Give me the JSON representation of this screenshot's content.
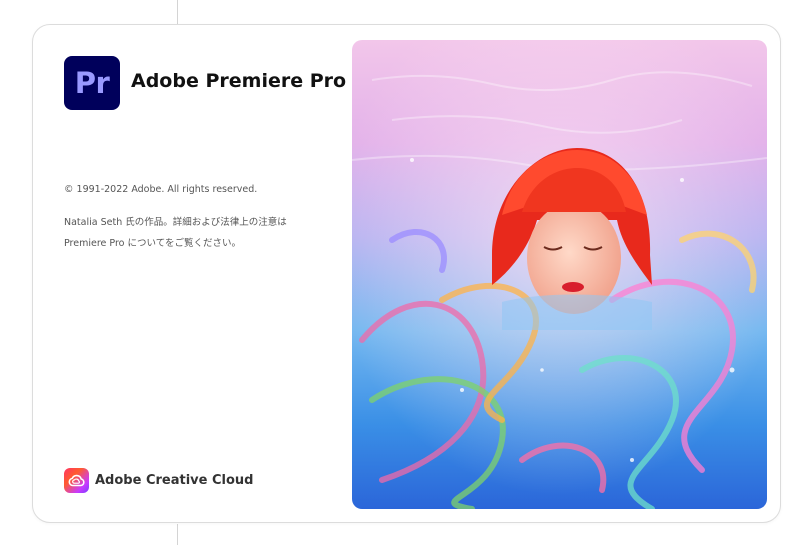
{
  "app": {
    "icon_text": "Pr",
    "name": "Adobe Premiere Pro"
  },
  "legal": {
    "copyright": "© 1991-2022 Adobe. All rights reserved.",
    "credit_line1": "Natalia Seth 氏の作品。詳細および法律上の注意は",
    "credit_line2": "Premiere Pro についてをご覧ください。"
  },
  "footer": {
    "brand": "Adobe Creative Cloud"
  },
  "colors": {
    "icon_background": "#00005b",
    "icon_text": "#9999ff"
  },
  "icons": {
    "app_icon": "premiere-pro-icon",
    "footer_icon": "creative-cloud-icon"
  }
}
